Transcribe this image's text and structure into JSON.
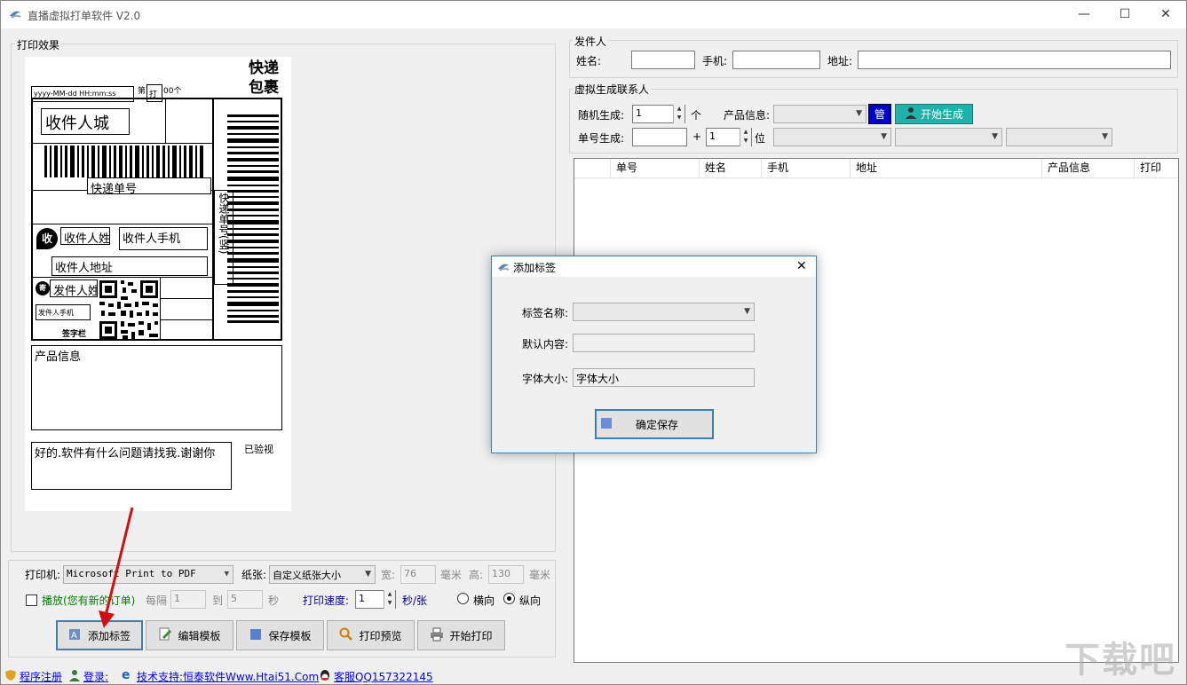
{
  "window": {
    "title": "直播虚拟打单软件 V2.0",
    "minimize": "—",
    "maximize": "☐",
    "close": "✕"
  },
  "print_effect": {
    "group_label": "打印效果",
    "label": {
      "express_title": "快递\n包裹",
      "datetime": "yyyy-MM-dd HH:mm:ss",
      "print_no_prefix": "第",
      "print_no_box": "打",
      "print_no_suffix": "00个",
      "recipient_city": "收件人城",
      "tracking_no": "快递单号",
      "tracking_no_vertical": "快递单号(竖)",
      "receive_badge": "收",
      "recipient_name": "收件人姓",
      "recipient_phone": "收件人手机",
      "recipient_address": "收件人地址",
      "send_badge": "寄",
      "sender_name": "发件人姓",
      "sender_phone": "发件人手机",
      "signature": "签字栏",
      "product_info": "产品信息",
      "note": "好的.软件有什么问题请找我.谢谢你",
      "inspected": "已验视"
    }
  },
  "print_settings": {
    "printer_label": "打印机:",
    "printer_value": "Microsoft Print to PDF",
    "paper_label": "纸张:",
    "paper_value": "自定义纸张大小",
    "width_label": "宽:",
    "width_value": "76",
    "width_unit": "毫米",
    "height_label": "高:",
    "height_value": "130",
    "height_unit": "毫米",
    "play_label": "播放(您有新的订单)",
    "interval_label": "每隔",
    "interval_value": "1",
    "to_label": "到",
    "to_value": "5",
    "sec_label": "秒",
    "speed_label": "打印速度:",
    "speed_value": "1",
    "speed_unit": "秒/张",
    "landscape_label": "横向",
    "portrait_label": "纵向",
    "orientation": "portrait"
  },
  "toolbar": {
    "add_label": "添加标签",
    "edit_template": "编辑模板",
    "save_template": "保存模板",
    "print_preview": "打印预览",
    "start_print": "开始打印"
  },
  "sender": {
    "group_label": "发件人",
    "name_label": "姓名:",
    "name_value": "",
    "phone_label": "手机:",
    "phone_value": "",
    "address_label": "地址:",
    "address_value": ""
  },
  "virtual": {
    "group_label": "虚拟生成联系人",
    "random_label": "随机生成:",
    "random_value": "1",
    "random_unit": "个",
    "product_label": "产品信息:",
    "product_value": "",
    "manage_button": "管",
    "generate_button": "开始生成",
    "order_label": "单号生成:",
    "order_value": "",
    "plus": "+",
    "digits_value": "1",
    "digits_unit": "位"
  },
  "table": {
    "columns": [
      "",
      "单号",
      "姓名",
      "手机",
      "地址",
      "产品信息",
      "打印"
    ],
    "rows": []
  },
  "dialog": {
    "title": "添加标签",
    "close": "✕",
    "tag_name_label": "标签名称:",
    "tag_name_value": "",
    "default_label": "默认内容:",
    "default_value": "",
    "font_label": "字体大小:",
    "font_value": "字体大小",
    "confirm_button": "确定保存"
  },
  "statusbar": {
    "register": "程序注册",
    "login": "登录:",
    "support": "技术支持:恒泰软件Www.Htai51.Com",
    "service": "客服QQ157322145"
  },
  "watermark": "下载吧",
  "colors": {
    "accent_blue": "#0000ee",
    "generate_btn": "#20b2aa",
    "manage_btn": "#0000cc",
    "play_label": "#008000",
    "dialog_border": "#3c7fb1"
  }
}
